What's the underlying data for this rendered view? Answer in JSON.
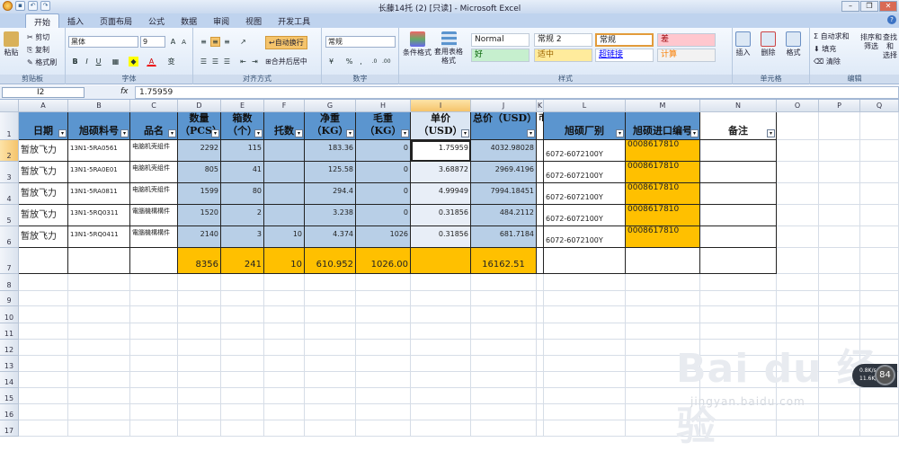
{
  "window": {
    "title": "长藤14托 (2)  [只读] - Microsoft Excel",
    "quick_access": [
      "save-icon",
      "undo-icon",
      "redo-icon"
    ],
    "controls": [
      "minimize",
      "restore",
      "close"
    ]
  },
  "tabs": [
    "开始",
    "插入",
    "页面布局",
    "公式",
    "数据",
    "审阅",
    "视图",
    "开发工具"
  ],
  "ribbon": {
    "clipboard": {
      "label": "剪贴板",
      "paste": "粘贴",
      "cut": "剪切",
      "copy": "复制",
      "format_painter": "格式刷"
    },
    "font": {
      "label": "字体",
      "font_name": "黑体",
      "font_size": "9",
      "bold": "B",
      "italic": "I",
      "underline": "U",
      "grow": "A",
      "shrink": "A",
      "char": "变"
    },
    "alignment": {
      "label": "对齐方式",
      "wrap": "自动换行",
      "merge": "合并后居中"
    },
    "number": {
      "label": "数字",
      "format": "常规",
      "percent": "%",
      "comma": ","
    },
    "styles": {
      "label": "样式",
      "cond_format": "条件格式",
      "table_format": "套用表格格式",
      "cells": [
        {
          "text": "Normal",
          "bg": "#ffffff",
          "color": "#222222"
        },
        {
          "text": "常规 2",
          "bg": "#ffffff",
          "color": "#222222"
        },
        {
          "text": "常规",
          "bg": "#ffffff",
          "color": "#222222"
        },
        {
          "text": "差",
          "bg": "#ffc7ce",
          "color": "#9c0006"
        },
        {
          "text": "好",
          "bg": "#c6efce",
          "color": "#006100"
        },
        {
          "text": "适中",
          "bg": "#ffeb9c",
          "color": "#9c6500"
        },
        {
          "text": "超链接",
          "bg": "#ffffff",
          "color": "#0000ff"
        },
        {
          "text": "计算",
          "bg": "#f2f2f2",
          "color": "#fa7d00"
        }
      ]
    },
    "cells": {
      "label": "单元格",
      "insert": "插入",
      "delete": "删除",
      "format": "格式"
    },
    "editing": {
      "label": "编辑",
      "autosum": "Σ 自动求和",
      "fill": "填充",
      "clear": "清除",
      "sort": "排序和\n筛选",
      "find": "查找和\n选择"
    }
  },
  "formula_bar": {
    "name_box": "I2",
    "fx": "fx",
    "value": "1.75959"
  },
  "columns": [
    "A",
    "B",
    "C",
    "D",
    "E",
    "F",
    "G",
    "H",
    "I",
    "J",
    "K",
    "L",
    "M",
    "N",
    "O",
    "P",
    "Q"
  ],
  "rows": [
    "1",
    "2",
    "3",
    "4",
    "5",
    "6",
    "7",
    "8",
    "9",
    "10",
    "11",
    "12",
    "13",
    "14",
    "15",
    "16",
    "17"
  ],
  "headers": {
    "A": "日期",
    "B": "旭硕料号",
    "C": "品名",
    "D": "数量（PCS）",
    "E": "箱数（个）",
    "F": "托数",
    "G": "净重（KG）",
    "H": "毛重（KG）",
    "I": "单价（USD）",
    "J": "总价（USD）",
    "K": "币",
    "L": "旭硕厂别",
    "M": "旭硕进口编号",
    "N": "备注"
  },
  "data_rows": [
    {
      "date": "暂放飞力",
      "part": "13N1-5RA0561",
      "name": "电脑机壳组件",
      "qty": "2292",
      "boxes": "115",
      "pallets": "",
      "net": "183.36",
      "gross": "0",
      "unit": "1.75959",
      "total": "4032.98028",
      "factory": "6072-6072100Y",
      "import_no": "0008617810"
    },
    {
      "date": "暂放飞力",
      "part": "13N1-5RA0E01",
      "name": "电脑机壳组件",
      "qty": "805",
      "boxes": "41",
      "pallets": "",
      "net": "125.58",
      "gross": "0",
      "unit": "3.68872",
      "total": "2969.4196",
      "factory": "6072-6072100Y",
      "import_no": "0008617810"
    },
    {
      "date": "暂放飞力",
      "part": "13N1-5RA0811",
      "name": "电脑机壳组件",
      "qty": "1599",
      "boxes": "80",
      "pallets": "",
      "net": "294.4",
      "gross": "0",
      "unit": "4.99949",
      "total": "7994.18451",
      "factory": "6072-6072100Y",
      "import_no": "0008617810"
    },
    {
      "date": "暂放飞力",
      "part": "13N1-5RQ0311",
      "name": "電腦機構構件",
      "qty": "1520",
      "boxes": "2",
      "pallets": "",
      "net": "3.238",
      "gross": "0",
      "unit": "0.31856",
      "total": "484.2112",
      "factory": "6072-6072100Y",
      "import_no": "0008617810"
    },
    {
      "date": "暂放飞力",
      "part": "13N1-5RQ0411",
      "name": "電腦機構構件",
      "qty": "2140",
      "boxes": "3",
      "pallets": "10",
      "net": "4.374",
      "gross": "1026",
      "unit": "0.31856",
      "total": "681.7184",
      "factory": "6072-6072100Y",
      "import_no": "0008617810"
    }
  ],
  "totals": {
    "qty": "8356",
    "boxes": "241",
    "pallets": "10",
    "net": "610.952",
    "gross": "1026.00",
    "total": "16162.51"
  },
  "watermark": {
    "text": "Bai du 经验",
    "url_text": "jingyan.baidu.com"
  },
  "speed_widget": {
    "up": "0.8K/s",
    "down": "11.6K/s",
    "value": "84"
  }
}
